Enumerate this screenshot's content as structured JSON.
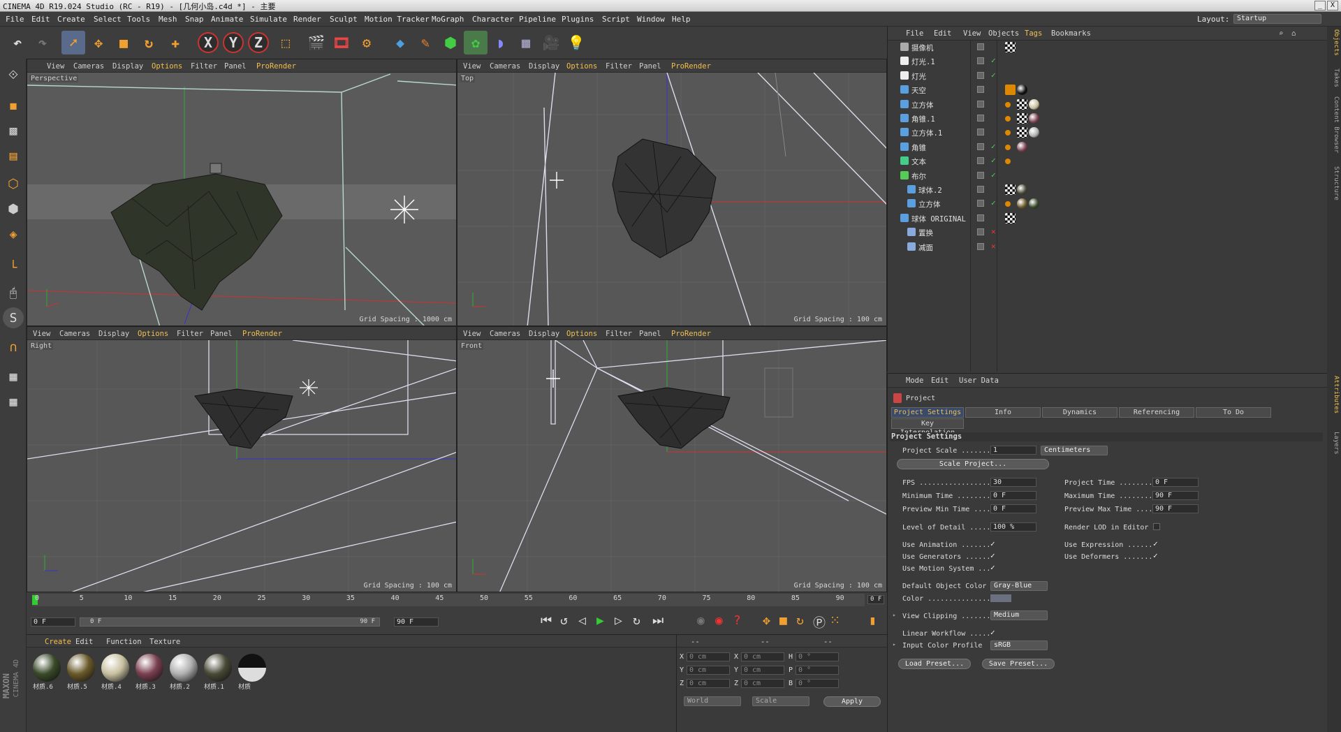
{
  "window": {
    "title": "CINEMA 4D R19.024 Studio (RC - R19) - [几何小岛.c4d *] - 主要",
    "controls": [
      "_",
      "□",
      "X"
    ]
  },
  "menu": [
    "File",
    "Edit",
    "Create",
    "Select",
    "Tools",
    "Mesh",
    "Snap",
    "Animate",
    "Simulate",
    "Render",
    "Sculpt",
    "Motion Tracker",
    "MoGraph",
    "Character",
    "Pipeline",
    "Plugins",
    "Script",
    "Window",
    "Help"
  ],
  "layout": {
    "label": "Layout:",
    "value": "Startup"
  },
  "viewports": [
    {
      "name": "Perspective",
      "menu": [
        "View",
        "Cameras",
        "Display",
        "Options",
        "Filter",
        "Panel",
        "ProRender"
      ],
      "grid": "Grid Spacing : 1000 cm"
    },
    {
      "name": "Top",
      "menu": [
        "View",
        "Cameras",
        "Display",
        "Options",
        "Filter",
        "Panel",
        "ProRender"
      ],
      "grid": "Grid Spacing : 100 cm"
    },
    {
      "name": "Right",
      "menu": [
        "View",
        "Cameras",
        "Display",
        "Options",
        "Filter",
        "Panel",
        "ProRender"
      ],
      "grid": "Grid Spacing : 100 cm"
    },
    {
      "name": "Front",
      "menu": [
        "View",
        "Cameras",
        "Display",
        "Options",
        "Filter",
        "Panel",
        "ProRender"
      ],
      "grid": "Grid Spacing : 100 cm"
    }
  ],
  "objects": {
    "menu": [
      "File",
      "Edit",
      "View",
      "Objects",
      "Tags",
      "Bookmarks"
    ],
    "items": [
      {
        "name": "摄像机",
        "indent": 0,
        "check": "none"
      },
      {
        "name": "灯光.1",
        "indent": 0,
        "check": "ok"
      },
      {
        "name": "灯光",
        "indent": 0,
        "check": "ok"
      },
      {
        "name": "天空",
        "indent": 0,
        "check": "none"
      },
      {
        "name": "立方体",
        "indent": 0,
        "check": "none"
      },
      {
        "name": "角锥.1",
        "indent": 0,
        "check": "none"
      },
      {
        "name": "立方体.1",
        "indent": 0,
        "check": "none"
      },
      {
        "name": "角锥",
        "indent": 0,
        "check": "ok"
      },
      {
        "name": "文本",
        "indent": 0,
        "check": "ok"
      },
      {
        "name": "布尔",
        "indent": 0,
        "check": "ok"
      },
      {
        "name": "球体.2",
        "indent": 1,
        "check": "none"
      },
      {
        "name": "立方体",
        "indent": 1,
        "check": "ok"
      },
      {
        "name": "球体 ORIGINAL",
        "indent": 0,
        "check": "none"
      },
      {
        "name": "置换",
        "indent": 1,
        "check": "x"
      },
      {
        "name": "减面",
        "indent": 1,
        "check": "x"
      }
    ]
  },
  "sidetabs": [
    "Objects",
    "Takes",
    "Content Browser",
    "Structure",
    "Attributes",
    "Layers"
  ],
  "attributes": {
    "menu": [
      "Mode",
      "Edit",
      "User Data"
    ],
    "object": "Project",
    "tabs": [
      "Project Settings",
      "Info",
      "Dynamics",
      "Referencing",
      "To Do"
    ],
    "tab2": "Key Interpolation",
    "section": "Project Settings",
    "project_scale_label": "Project Scale .......",
    "project_scale": "1",
    "scale_unit": "Centimeters",
    "scale_button": "Scale Project...",
    "fps_label": "FPS .................",
    "fps": "30",
    "project_time_label": "Project Time ........",
    "project_time": "0 F",
    "min_time_label": "Minimum Time ........",
    "min_time": "0 F",
    "max_time_label": "Maximum Time ........",
    "max_time": "90 F",
    "prev_min_label": "Preview Min Time ....",
    "prev_min": "0 F",
    "prev_max_label": "Preview Max Time ....",
    "prev_max": "90 F",
    "lod_label": "Level of Detail .....",
    "lod": "100 %",
    "render_lod_label": "Render LOD in Editor",
    "use_anim": "Use Animation .......",
    "use_expr": "Use Expression ......",
    "use_gen": "Use Generators ......",
    "use_def": "Use Deformers .......",
    "use_motion": "Use Motion System ...",
    "def_color_label": "Default Object Color",
    "def_color": "Gray-Blue",
    "color_label": "Color ...............",
    "clipping_label": "View Clipping .......",
    "clipping": "Medium",
    "linear_label": "Linear Workflow .....",
    "profile_label": "Input Color Profile",
    "profile": "sRGB",
    "load_preset": "Load Preset...",
    "save_preset": "Save Preset..."
  },
  "timeline": {
    "ticks": [
      "0",
      "5",
      "10",
      "15",
      "20",
      "25",
      "30",
      "35",
      "40",
      "45",
      "50",
      "55",
      "60",
      "65",
      "70",
      "75",
      "80",
      "85",
      "90"
    ],
    "frame_field": "0 F",
    "start": "0 F",
    "range_start": "0 F",
    "range_end": "90 F",
    "end": "90 F",
    "current": "0 F"
  },
  "materials": {
    "menu": [
      "Create",
      "Edit",
      "Function",
      "Texture"
    ],
    "items": [
      {
        "name": "材质.6",
        "color": "#3a4a2a"
      },
      {
        "name": "材质.5",
        "color": "#6a5a2a"
      },
      {
        "name": "材质.4",
        "color": "#c8c0a0"
      },
      {
        "name": "材质.3",
        "color": "#7a4050"
      },
      {
        "name": "材质.2",
        "color": "#b0b0b0"
      },
      {
        "name": "材质.1",
        "color": "#4a4a38"
      },
      {
        "name": "材质",
        "color": "#222222"
      }
    ]
  },
  "coords": {
    "dashes": [
      "--",
      "--",
      "--"
    ],
    "rows": [
      [
        "X",
        "0 cm",
        "X",
        "0 cm",
        "H",
        "0 °"
      ],
      [
        "Y",
        "0 cm",
        "Y",
        "0 cm",
        "P",
        "0 °"
      ],
      [
        "Z",
        "0 cm",
        "Z",
        "0 cm",
        "B",
        "0 °"
      ]
    ],
    "world": "World",
    "scale": "Scale",
    "apply": "Apply"
  },
  "brand": [
    "MAXON",
    "CINEMA 4D"
  ]
}
